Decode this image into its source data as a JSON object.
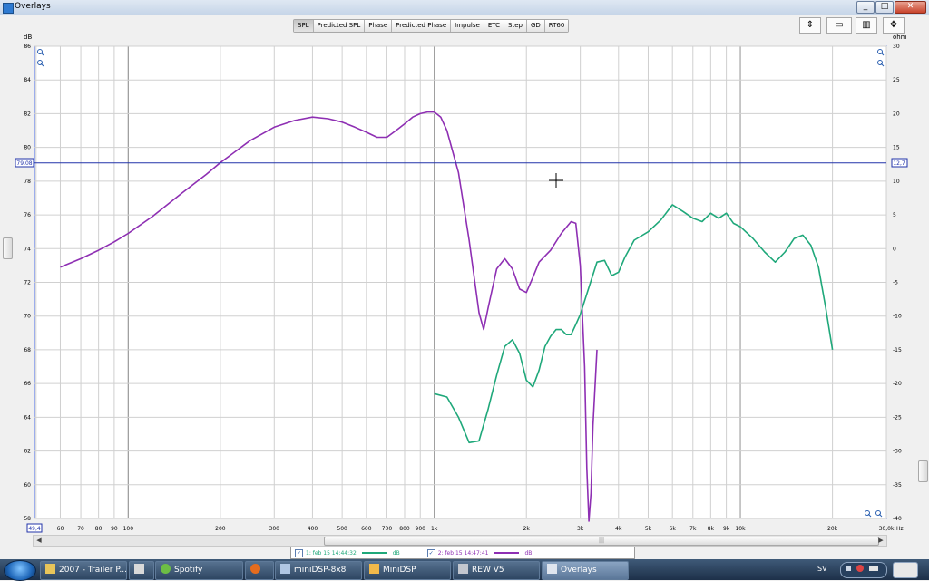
{
  "window": {
    "title": "Overlays",
    "controls": [
      "_",
      "□",
      "✕"
    ]
  },
  "tabs": [
    "SPL",
    "Predicted SPL",
    "Phase",
    "Predicted Phase",
    "Impulse",
    "ETC",
    "Step",
    "GD",
    "RT60"
  ],
  "active_tab": "SPL",
  "toolbar": {
    "icons": [
      "fit-icon",
      "controls-icon",
      "grid-icon",
      "zoom-icon"
    ]
  },
  "plot": {
    "left_unit": "dB",
    "right_unit": "ohm",
    "cursor_left_value": "79,08",
    "cursor_right_value": "12,7",
    "freq_cursor_value": "49,4",
    "x_unit": "Hz"
  },
  "chart_data": {
    "type": "line",
    "title": "",
    "xlabel": "Hz",
    "ylabel": "dB",
    "y2label": "ohm",
    "x_scale": "log",
    "xlim": [
      49.4,
      30000
    ],
    "ylim": [
      58,
      86
    ],
    "y2lim": [
      -40,
      30
    ],
    "grid": true,
    "x_ticks": [
      "60",
      "70",
      "80",
      "90",
      "100",
      "200",
      "300",
      "400",
      "500",
      "600",
      "700",
      "800",
      "900",
      "1k",
      "2k",
      "3k",
      "4k",
      "5k",
      "6k",
      "7k",
      "8k",
      "9k",
      "10k",
      "20k",
      "30,0k"
    ],
    "y_ticks": [
      58,
      60,
      62,
      64,
      66,
      68,
      70,
      72,
      74,
      76,
      78,
      80,
      82,
      84,
      86
    ],
    "y2_ticks": [
      -40,
      -35,
      -30,
      -25,
      -20,
      -15,
      -10,
      -5,
      0,
      5,
      10,
      15,
      20,
      25,
      30
    ],
    "hline_y": 79.08,
    "series": [
      {
        "name": "2: feb 15 14:47:41",
        "color": "#8e2fb3",
        "x": [
          60,
          70,
          80,
          90,
          100,
          120,
          150,
          180,
          200,
          250,
          300,
          350,
          400,
          450,
          500,
          550,
          600,
          650,
          700,
          750,
          800,
          850,
          900,
          950,
          1000,
          1050,
          1100,
          1200,
          1300,
          1400,
          1450,
          1500,
          1600,
          1700,
          1800,
          1900,
          2000,
          2100,
          2200,
          2400,
          2600,
          2800,
          2900,
          3000,
          3100,
          3150,
          3200,
          3250,
          3300,
          3400
        ],
        "values": [
          72.9,
          73.4,
          73.9,
          74.4,
          74.9,
          75.9,
          77.3,
          78.4,
          79.1,
          80.4,
          81.2,
          81.6,
          81.8,
          81.7,
          81.5,
          81.2,
          80.9,
          80.6,
          80.6,
          81.0,
          81.4,
          81.8,
          82.0,
          82.1,
          82.1,
          81.8,
          81.0,
          78.5,
          74.5,
          70.2,
          69.2,
          70.5,
          72.8,
          73.4,
          72.8,
          71.6,
          71.4,
          72.3,
          73.2,
          73.9,
          74.9,
          75.6,
          75.5,
          73.0,
          67.0,
          61.0,
          57.8,
          59.5,
          63.5,
          68.0
        ]
      },
      {
        "name": "1: feb 15 14:44:32",
        "color": "#1fa87a",
        "x": [
          1000,
          1100,
          1200,
          1300,
          1400,
          1500,
          1600,
          1700,
          1800,
          1900,
          2000,
          2100,
          2200,
          2300,
          2400,
          2500,
          2600,
          2700,
          2800,
          2900,
          3000,
          3200,
          3400,
          3600,
          3800,
          4000,
          4200,
          4500,
          5000,
          5500,
          6000,
          6500,
          7000,
          7500,
          8000,
          8500,
          9000,
          9500,
          10000,
          11000,
          12000,
          13000,
          14000,
          15000,
          16000,
          17000,
          18000,
          19000,
          20000
        ],
        "values": [
          65.4,
          65.2,
          64.0,
          62.5,
          62.6,
          64.5,
          66.5,
          68.2,
          68.6,
          67.8,
          66.2,
          65.8,
          66.8,
          68.2,
          68.8,
          69.2,
          69.2,
          68.9,
          68.9,
          69.5,
          70.1,
          71.7,
          73.2,
          73.3,
          72.4,
          72.6,
          73.5,
          74.5,
          75.0,
          75.7,
          76.6,
          76.2,
          75.8,
          75.6,
          76.1,
          75.8,
          76.1,
          75.5,
          75.3,
          74.6,
          73.8,
          73.2,
          73.8,
          74.6,
          74.8,
          74.2,
          72.9,
          70.5,
          68.0
        ]
      }
    ]
  },
  "legend": [
    {
      "checked": true,
      "label": "1: feb 15 14:44:32",
      "unit": "dB"
    },
    {
      "checked": true,
      "label": "2: feb 15 14:47:41",
      "unit": "dB"
    }
  ],
  "taskbar": {
    "items": [
      "2007 - Trailer P...",
      "",
      "Spotify",
      "",
      "miniDSP-8x8",
      "MiniDSP",
      "REW V5",
      "Overlays"
    ],
    "active_item": "Overlays",
    "language": "SV"
  },
  "colors": {
    "accent": "#2233aa",
    "plot_border": "#3a5bd8",
    "purple_trace": "#8e2fb3",
    "green_trace": "#1fa87a"
  }
}
